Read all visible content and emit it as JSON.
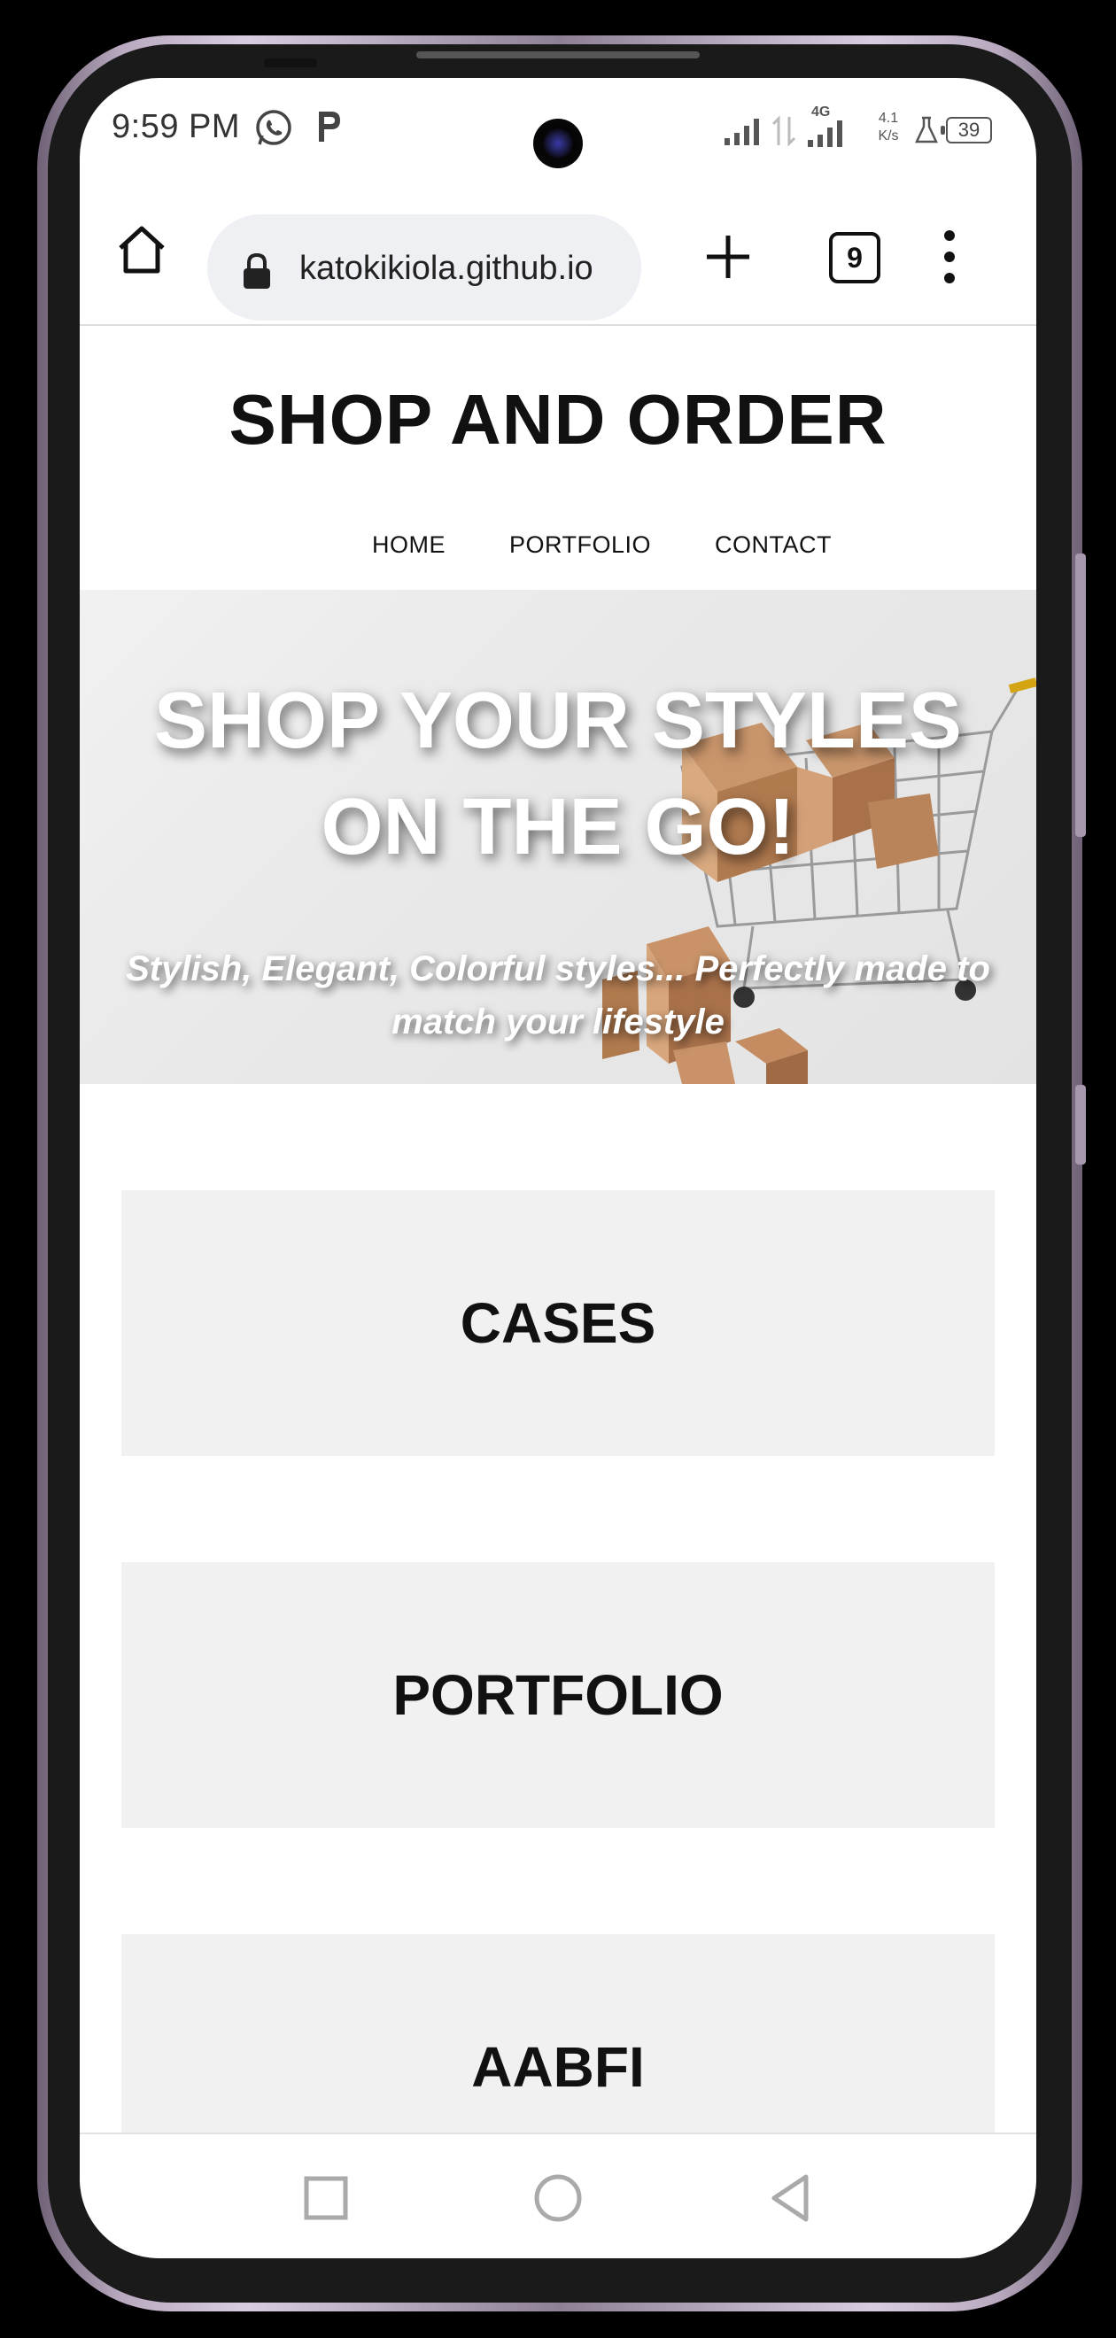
{
  "status_bar": {
    "time": "9:59 PM",
    "network_type": "4G",
    "net_speed_value": "4.1",
    "net_speed_unit": "K/s",
    "battery_level": "39",
    "icons": [
      "whatsapp-icon",
      "p-icon",
      "signal-icon",
      "data-transfer-icon",
      "flask-icon",
      "battery-icon"
    ]
  },
  "browser": {
    "url": "katokikiola.github.io",
    "tab_count": "9"
  },
  "site": {
    "title": "SHOP AND ORDER",
    "nav": [
      "HOME",
      "PORTFOLIO",
      "CONTACT"
    ],
    "hero_title": "SHOP YOUR STYLES ON THE GO!",
    "hero_subtitle": "Stylish, Elegant, Colorful styles... Perfectly made to match your lifestyle",
    "cards": [
      "CASES",
      "PORTFOLIO",
      "AABFI"
    ]
  },
  "colors": {
    "card_bg": "#f1f1f1",
    "hero_bg": "#e9e9e9",
    "url_bg": "#eef0f4"
  }
}
